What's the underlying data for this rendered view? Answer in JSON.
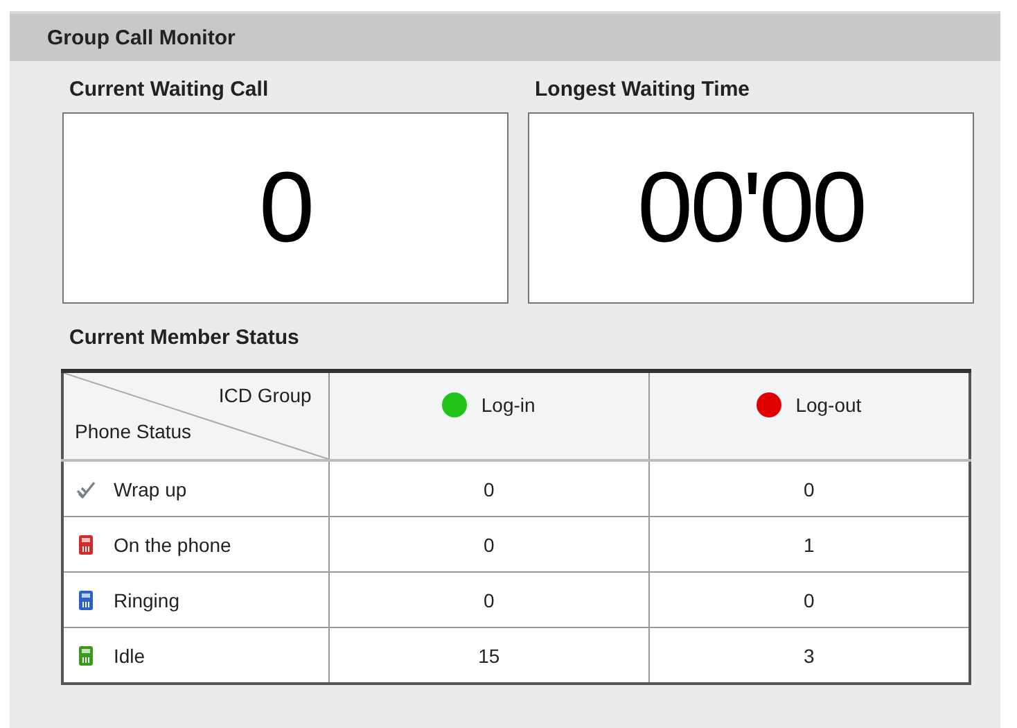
{
  "panel": {
    "title": "Group Call Monitor"
  },
  "stats": [
    {
      "label": "Current Waiting Call",
      "value": "0"
    },
    {
      "label": "Longest Waiting Time",
      "value": "00'00"
    }
  ],
  "member_status": {
    "title": "Current Member Status",
    "corner": {
      "top": "ICD Group",
      "bottom": "Phone Status"
    },
    "columns": [
      {
        "label": "Log-in",
        "color": "#22c41a"
      },
      {
        "label": "Log-out",
        "color": "#e00000"
      }
    ],
    "rows": [
      {
        "kind": "wrapup",
        "label": "Wrap up",
        "values": [
          "0",
          "0"
        ]
      },
      {
        "kind": "onphone",
        "label": "On the phone",
        "values": [
          "0",
          "1"
        ]
      },
      {
        "kind": "ringing",
        "label": "Ringing",
        "values": [
          "0",
          "0"
        ]
      },
      {
        "kind": "idle",
        "label": "Idle",
        "values": [
          "15",
          "3"
        ]
      }
    ]
  }
}
